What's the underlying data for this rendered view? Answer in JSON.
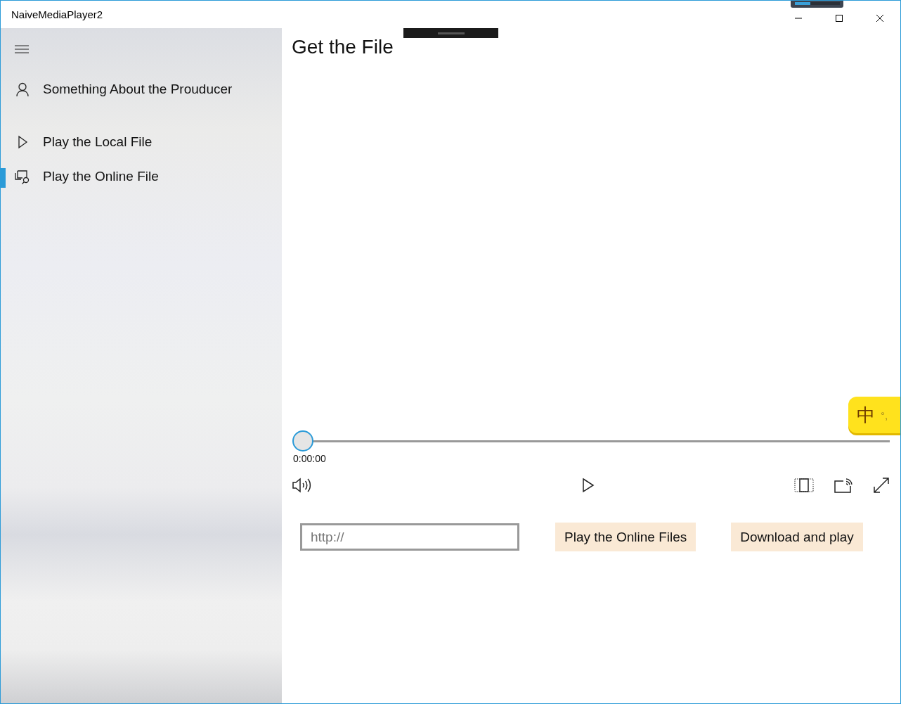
{
  "window": {
    "title": "NaiveMediaPlayer2"
  },
  "nav": {
    "items": [
      {
        "label": "Something About the Prouducer",
        "selected": false
      },
      {
        "label": "Play the Local File",
        "selected": false
      },
      {
        "label": "Play the Online File",
        "selected": true
      }
    ]
  },
  "page": {
    "title": "Get the File"
  },
  "player": {
    "position": {
      "level": 0
    },
    "time": "0:00:00"
  },
  "url_field": {
    "placeholder": "http://"
  },
  "buttons": [
    "Play the Online Files",
    "Download and play"
  ],
  "ime": {
    "mode": "中",
    "punctuation": "°,"
  }
}
